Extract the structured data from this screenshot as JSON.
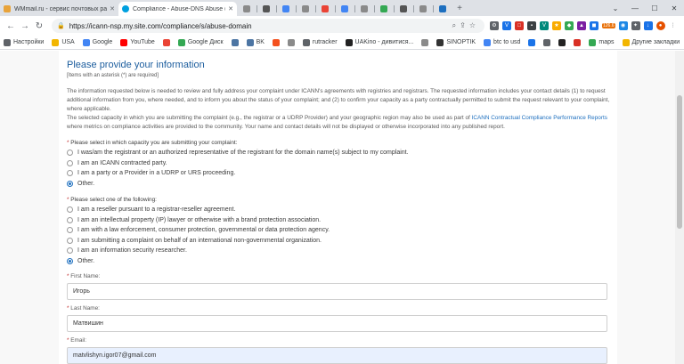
{
  "browser": {
    "tabs": [
      {
        "title": "WMmail.ru - сервис почтовых ра",
        "favicon_color": "#e8a33a",
        "active": false
      },
      {
        "title": "Compliance - Abuse-DNS Abuse (",
        "favicon_color": "#00a0df",
        "active": true
      },
      {
        "title": "",
        "favicon_color": "#8a8a8a",
        "active": false
      },
      {
        "title": "",
        "favicon_color": "#555555",
        "active": false
      },
      {
        "title": "",
        "favicon_color": "#4285f4",
        "active": false
      },
      {
        "title": "",
        "favicon_color": "#8a8a8a",
        "active": false
      },
      {
        "title": "",
        "favicon_color": "#ea4335",
        "active": false
      },
      {
        "title": "",
        "favicon_color": "#4285f4",
        "active": false
      },
      {
        "title": "",
        "favicon_color": "#8a8a8a",
        "active": false
      },
      {
        "title": "",
        "favicon_color": "#34a853",
        "active": false
      },
      {
        "title": "",
        "favicon_color": "#555555",
        "active": false
      },
      {
        "title": "",
        "favicon_color": "#8a8a8a",
        "active": false
      },
      {
        "title": "",
        "favicon_color": "#1d6fbf",
        "active": false
      }
    ],
    "url": "https://icann-nsp.my.site.com/compliance/s/abuse-domain",
    "extension_badge": "126.6",
    "bookmarks": [
      {
        "label": "Настройки",
        "color": "#5f6368"
      },
      {
        "label": "USA",
        "color": "#f2b600"
      },
      {
        "label": "Google",
        "color": "#4285f4"
      },
      {
        "label": "YouTube",
        "color": "#ff0000"
      },
      {
        "label": "",
        "color": "#ea4335"
      },
      {
        "label": "Google Диск",
        "color": "#34a853"
      },
      {
        "label": "",
        "color": "#4c75a3"
      },
      {
        "label": "BK",
        "color": "#4c75a3"
      },
      {
        "label": "",
        "color": "#f4511e"
      },
      {
        "label": "",
        "color": "#8a8a8a"
      },
      {
        "label": "rutracker",
        "color": "#5f6368"
      },
      {
        "label": "UAKino - дивитися...",
        "color": "#222222"
      },
      {
        "label": "",
        "color": "#8a8a8a"
      },
      {
        "label": "SINOPTIK",
        "color": "#333333"
      },
      {
        "label": "btc to usd",
        "color": "#4285f4"
      },
      {
        "label": "",
        "color": "#1a73e8"
      },
      {
        "label": "",
        "color": "#5f6368"
      },
      {
        "label": "",
        "color": "#222222"
      },
      {
        "label": "",
        "color": "#d93025"
      },
      {
        "label": "maps",
        "color": "#34a853"
      }
    ],
    "other_bookmarks": "Другие закладки"
  },
  "form": {
    "title": "Please provide your information",
    "required_note": "[Items with an asterisk (*) are required]",
    "intro_p1": "The information requested below is needed to review and fully address your complaint under ICANN's agreements with registries and registrars. The requested information includes your contact details (1) to request additional information from you, where needed, and to inform you about the status of your complaint; and (2) to confirm your capacity as a party contractually permitted to submit the request relevant to your complaint, where applicable.",
    "intro_p2_a": "The selected capacity in which you are submitting the complaint (e.g., the registrar or a UDRP Provider) and your geographic region may also be used as part of ",
    "intro_link": "ICANN Contractual Compliance Performance Reports",
    "intro_p2_b": " where metrics on compliance activities are provided to the community. Your name and contact details will not be displayed or otherwise incorporated into any published report.",
    "q1": {
      "label": "Please select in which capacity you are submitting your complaint:",
      "options": [
        {
          "label": "I was/am the registrant or an authorized representative of the registrant for the domain name(s) subject to my complaint.",
          "selected": false
        },
        {
          "label": "I am an ICANN contracted party.",
          "selected": false
        },
        {
          "label": "I am a party or a Provider in a UDRP or URS proceeding.",
          "selected": false
        },
        {
          "label": "Other.",
          "selected": true
        }
      ]
    },
    "q2": {
      "label": "Please select one of the following:",
      "options": [
        {
          "label": "I am a reseller pursuant to a registrar-reseller agreement.",
          "selected": false
        },
        {
          "label": "I am an intellectual property (IP) lawyer or otherwise with a brand protection association.",
          "selected": false
        },
        {
          "label": "I am with a law enforcement, consumer protection, governmental or data protection agency.",
          "selected": false
        },
        {
          "label": "I am submitting a complaint on behalf of an international non-governmental organization.",
          "selected": false
        },
        {
          "label": "I am an information security researcher.",
          "selected": false
        },
        {
          "label": "Other.",
          "selected": true
        }
      ]
    },
    "first_name": {
      "label": "First Name:",
      "value": "Игорь"
    },
    "last_name": {
      "label": "Last Name:",
      "value": "Матвишин"
    },
    "email": {
      "label": "Email:",
      "value": "matvlishyn.igor07@gmail.com"
    }
  }
}
